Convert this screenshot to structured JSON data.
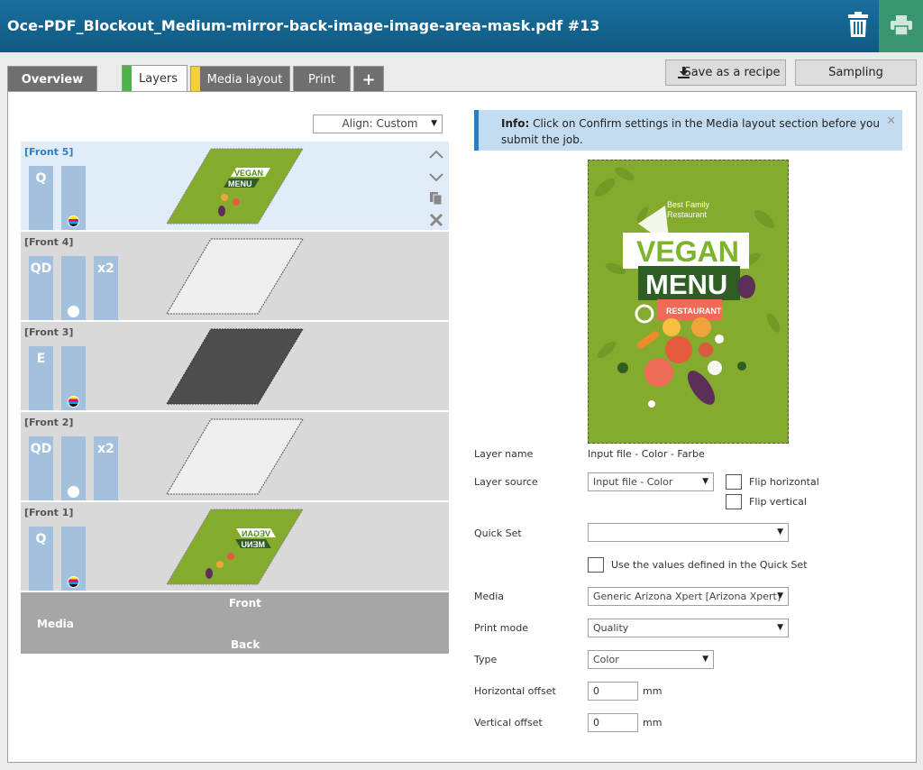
{
  "window": {
    "title": "Oce-PDF_Blockout_Medium-mirror-back-image-image-area-mask.pdf #13"
  },
  "tabs": {
    "overview": "Overview",
    "layers": "Layers",
    "media_layout": "Media layout",
    "print": "Print",
    "add": "+",
    "layers_color": "#4cb34c",
    "media_layout_color": "#f4cf3b"
  },
  "actions": {
    "save_recipe": "Save as a recipe",
    "sampling": "Sampling"
  },
  "align": {
    "label": "Align: Custom"
  },
  "layers": [
    {
      "name": "[Front 5]",
      "mode": "Q",
      "ink": "cmyk",
      "count": "",
      "content": "vegan-image",
      "selected": true
    },
    {
      "name": "[Front 4]",
      "mode": "QD",
      "ink": "white",
      "count": "x2",
      "content": "white"
    },
    {
      "name": "[Front 3]",
      "mode": "E",
      "ink": "cmyk",
      "count": "",
      "content": "dark"
    },
    {
      "name": "[Front 2]",
      "mode": "QD",
      "ink": "white",
      "count": "x2",
      "content": "white"
    },
    {
      "name": "[Front 1]",
      "mode": "Q",
      "ink": "cmyk",
      "count": "",
      "content": "vegan-image-mirrored"
    }
  ],
  "media_block": {
    "label": "Media",
    "front": "Front",
    "back": "Back"
  },
  "thumb_text": {
    "vegan": "VEGAN",
    "menu": "MENU"
  },
  "info": {
    "prefix": "Info:",
    "line1": " Click on Confirm settings in the Media layout section before you",
    "line2": "submit the job."
  },
  "preview": {
    "best_family": "Best Family",
    "restaurant_top": "Restaurant",
    "vegan": "VEGAN",
    "menu": "MENU",
    "restaurant_badge": "RESTAURANT"
  },
  "form": {
    "layer_name_label": "Layer name",
    "layer_name_value": "Input file - Color - Farbe",
    "layer_source_label": "Layer source",
    "layer_source_value": "Input file - Color",
    "flip_horizontal": "Flip horizontal",
    "flip_vertical": "Flip vertical",
    "quick_set_label": "Quick Set",
    "quick_set_value": "",
    "use_quick_set": "Use the values defined in the Quick Set",
    "media_label": "Media",
    "media_value": "Generic Arizona Xpert [Arizona Xpert]",
    "print_mode_label": "Print mode",
    "print_mode_value": "Quality",
    "type_label": "Type",
    "type_value": "Color",
    "h_offset_label": "Horizontal offset",
    "h_offset_value": "0",
    "v_offset_label": "Vertical offset",
    "v_offset_value": "0",
    "unit": "mm"
  }
}
